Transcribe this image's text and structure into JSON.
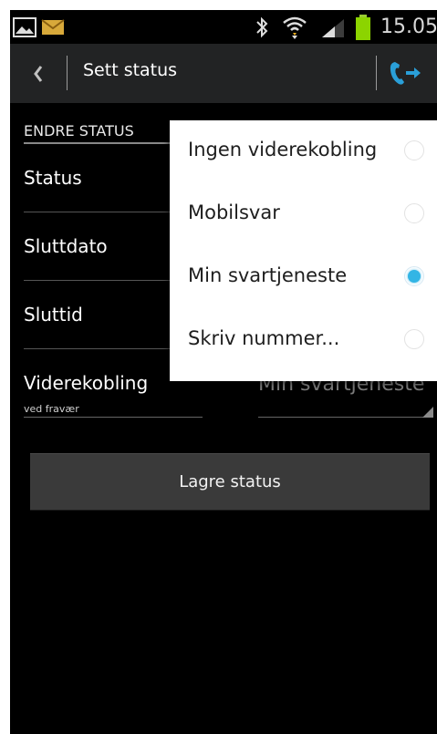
{
  "status_bar": {
    "time": "15.05",
    "icons": [
      "gallery-icon",
      "email-icon",
      "bluetooth-icon",
      "wifi-icon",
      "signal-icon",
      "battery-icon"
    ]
  },
  "action_bar": {
    "title": "Sett status",
    "back_icon": "chevron-left-icon",
    "logout_icon": "phone-forward-icon"
  },
  "form": {
    "section_header": "ENDRE STATUS",
    "status_label": "Status",
    "end_date_label": "Sluttdato",
    "end_time_label": "Sluttid",
    "forwarding_label": "Viderekobling",
    "forwarding_sub": "ved fravær",
    "forwarding_value": "Min svartjeneste",
    "save_button": "Lagre status"
  },
  "popup": {
    "options": [
      {
        "label": "Ingen viderekobling",
        "selected": false
      },
      {
        "label": "Mobilsvar",
        "selected": false
      },
      {
        "label": "Min svartjeneste",
        "selected": true
      },
      {
        "label": "Skriv nummer...",
        "selected": false
      }
    ]
  },
  "colors": {
    "accent": "#33b5e5",
    "action_bar": "#222324",
    "background": "#000000"
  }
}
